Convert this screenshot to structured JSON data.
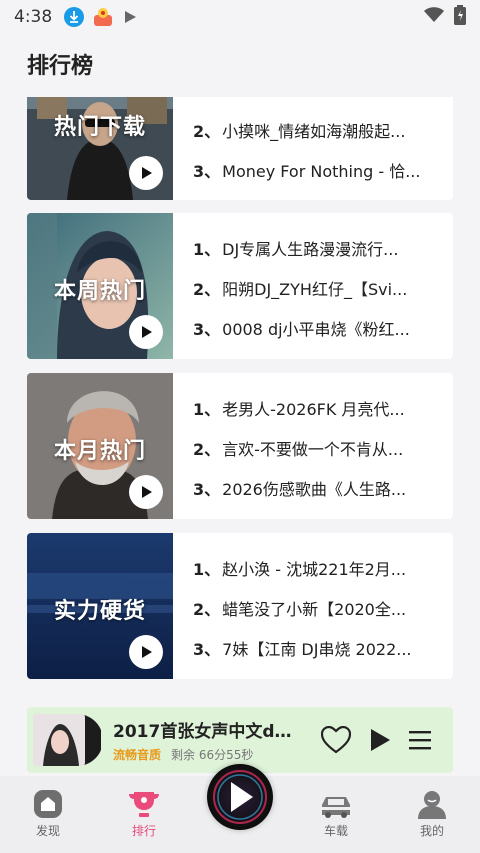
{
  "status_bar": {
    "time": "4:38"
  },
  "page": {
    "title": "排行榜"
  },
  "charts": [
    {
      "label": "热门下载",
      "tracks": [
        {
          "num": "2、",
          "title": "小摸咪_情绪如海潮般起..."
        },
        {
          "num": "3、",
          "title": "Money For Nothing - 恰..."
        }
      ]
    },
    {
      "label": "本周热门",
      "tracks": [
        {
          "num": "1、",
          "title": "DJ专属人生路漫漫流行..."
        },
        {
          "num": "2、",
          "title": "阳朔DJ_ZYH红仔_【Svi..."
        },
        {
          "num": "3、",
          "title": "0008 dj小平串烧《粉红..."
        }
      ]
    },
    {
      "label": "本月热门",
      "tracks": [
        {
          "num": "1、",
          "title": "老男人-2026FK 月亮代..."
        },
        {
          "num": "2、",
          "title": "言欢-不要做一个不肯从..."
        },
        {
          "num": "3、",
          "title": "2026伤感歌曲《人生路..."
        }
      ]
    },
    {
      "label": "实力硬货",
      "tracks": [
        {
          "num": "1、",
          "title": "赵小涣 - 沈城221年2月..."
        },
        {
          "num": "2、",
          "title": "蜡笔没了小新【2020全..."
        },
        {
          "num": "3、",
          "title": "7妹【江南 DJ串烧 2022..."
        }
      ]
    }
  ],
  "mini_player": {
    "title": "2017首张女声中文dj..",
    "quality": "流畅音质",
    "remaining": "剩余 66分55秒"
  },
  "nav": {
    "discover": "发现",
    "ranking": "排行",
    "car": "车载",
    "mine": "我的"
  },
  "colors": {
    "accent": "#e94b7a",
    "quality": "#e89a1b",
    "player_bg": "#dff3d9"
  }
}
